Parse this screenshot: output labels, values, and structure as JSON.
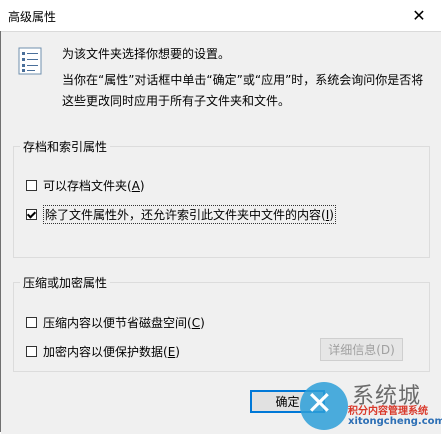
{
  "window": {
    "title": "高级属性",
    "close_glyph": "✕"
  },
  "intro": "为该文件夹选择你想要的设置。",
  "description": "当你在“属性”对话框中单击“确定”或“应用”时，系统会询问你是否将这些更改同时应用于所有子文件夹和文件。",
  "archive_group": {
    "legend": "存档和索引属性",
    "items": [
      {
        "label": "可以存档文件夹",
        "accel": "A",
        "checked": false
      },
      {
        "label": "除了文件属性外，还允许索引此文件夹中文件的内容",
        "accel": "I",
        "checked": true
      }
    ]
  },
  "compress_group": {
    "legend": "压缩或加密属性",
    "items": [
      {
        "label": "压缩内容以便节省磁盘空间",
        "accel": "C",
        "checked": false
      },
      {
        "label": "加密内容以便保护数据",
        "accel": "E",
        "checked": false
      }
    ],
    "details_button": "详细信息(D)"
  },
  "ok_button": "确定",
  "watermark": {
    "brand": "系统城",
    "sub": "积分内容管理系统",
    "url": "xitongcheng.com"
  },
  "colors": {
    "dialog_bg": "#f0f0f0",
    "accent_blue": "#0078d7",
    "disabled_text": "#a0a0a0"
  }
}
